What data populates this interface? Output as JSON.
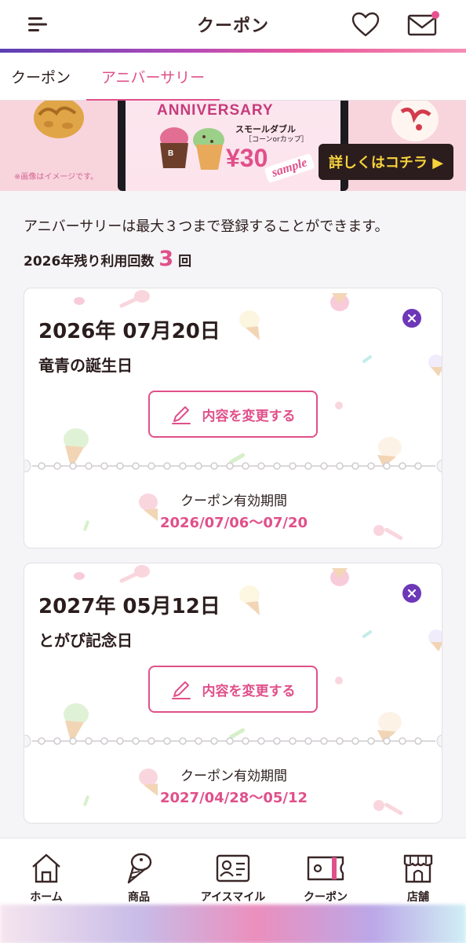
{
  "header": {
    "title": "クーポン",
    "menu_icon": "hamburger-menu-icon",
    "favorite_icon": "heart-icon",
    "mail_icon": "mail-icon",
    "mail_badge_color": "#e9508f"
  },
  "tabs": [
    {
      "label": "クーポン",
      "active": false
    },
    {
      "label": "アニバーサリー",
      "active": true
    }
  ],
  "banner": {
    "title": "ANNIVERSARY",
    "product": "スモールダブル",
    "sub": "［コーンorカップ］",
    "price": "¥30",
    "sample": "sample",
    "note": "※画像はイメージです。",
    "more_button": "詳しくはコチラ ▶"
  },
  "info_text": "アニバーサリーは最大３つまで登録することができます。",
  "remaining": {
    "prefix": "2026年残り利用回数",
    "count": "3",
    "suffix": "回"
  },
  "anniversaries": [
    {
      "date": "2026年 07月20日",
      "name": "竜青の誕生日",
      "edit_label": "内容を変更する",
      "period_label": "クーポン有効期間",
      "period": "2026/07/06～07/20"
    },
    {
      "date": "2027年 05月12日",
      "name": "とがぴ記念日",
      "edit_label": "内容を変更する",
      "period_label": "クーポン有効期間",
      "period": "2027/04/28～05/12"
    }
  ],
  "bottom_nav": [
    {
      "label": "ホーム",
      "icon": "home-icon"
    },
    {
      "label": "商品",
      "icon": "ice-cream-cone-icon"
    },
    {
      "label": "アイスマイル",
      "icon": "member-card-icon"
    },
    {
      "label": "クーポン",
      "icon": "coupon-ticket-icon"
    },
    {
      "label": "店舗",
      "icon": "store-icon"
    }
  ],
  "colors": {
    "accent_pink": "#e0508a",
    "delete_purple": "#6d38b8",
    "text_dark": "#2b1d1d"
  }
}
